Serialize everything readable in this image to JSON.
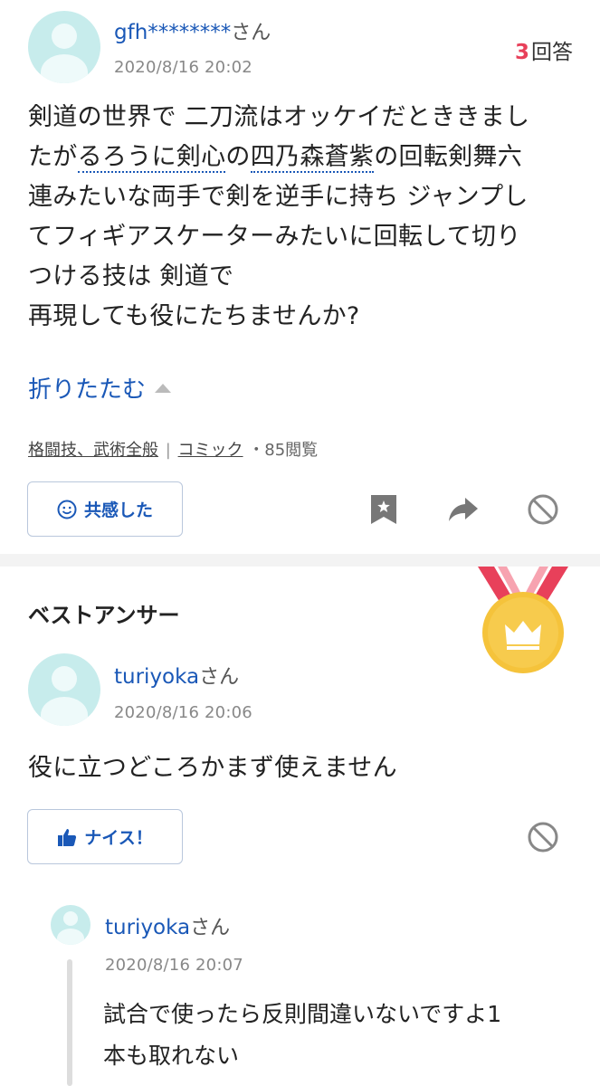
{
  "question": {
    "user": "gfh********",
    "honorific": "さん",
    "date": "2020/8/16 20:02",
    "answer_count": "3",
    "answer_label": "回答",
    "text_lines": [
      "剣道の世界で 二刀流はオッケイだとききまし",
      "たが",
      "るろうに剣心",
      "の",
      "四乃森蒼紫",
      "の回転剣舞六",
      "連みたいな両手で剣を逆手に持ち ジャンプし",
      "てフィギアスケーターみたいに回転して切り",
      "つける技は 剣道で",
      "再現しても役にたちませんか?"
    ],
    "collapse_label": "折りたたむ",
    "category1": "格闘技、武術全般",
    "separator": "|",
    "category2": "コミック",
    "views": "・85閲覧",
    "empathy_label": "共感した",
    "icons": [
      "smile-icon",
      "bookmark-icon",
      "share-icon",
      "block-icon",
      "chevron-up-icon"
    ]
  },
  "best_answer": {
    "heading": "ベストアンサー",
    "user": "turiyoka",
    "honorific": "さん",
    "date": "2020/8/16 20:06",
    "text": "役に立つどころかまず使えません",
    "nice_label": "ナイス！",
    "icons": [
      "medal-icon",
      "crown-icon",
      "thumbs-up-icon",
      "block-icon"
    ]
  },
  "reply": {
    "user": "turiyoka",
    "honorific": "さん",
    "date": "2020/8/16 20:07",
    "text_line1": "試合で使ったら反則間違いないですよ1",
    "text_line2": "本も取れない"
  },
  "colors": {
    "link": "#1a58b7",
    "answer_count": "#e8405a",
    "avatar": "#c7ecec",
    "medal_gold": "#f5c33b",
    "ribbon": "#e8405a"
  }
}
